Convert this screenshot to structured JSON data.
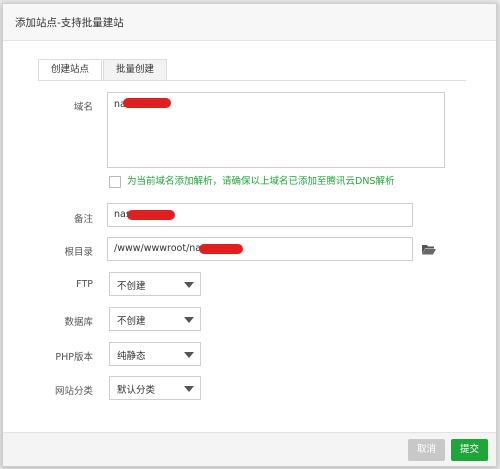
{
  "dialog": {
    "title": "添加站点-支持批量建站",
    "close_glyph": "✕"
  },
  "tabs": [
    {
      "label": "创建站点",
      "active": true
    },
    {
      "label": "批量创建",
      "active": false
    }
  ],
  "form": {
    "domain_label": "域名",
    "domain_value": "nas",
    "dns_checkbox_text": "为当前域名添加解析，请确保以上域名已添加至腾讯云DNS解析",
    "note_label": "备注",
    "note_value": "nas",
    "root_label": "根目录",
    "root_value": "/www/wwwroot/nas",
    "ftp_label": "FTP",
    "ftp_value": "不创建",
    "db_label": "数据库",
    "db_value": "不创建",
    "php_label": "PHP版本",
    "php_value": "纯静态",
    "category_label": "网站分类",
    "category_value": "默认分类"
  },
  "footer": {
    "cancel_label": "取消",
    "submit_label": "提交"
  },
  "colors": {
    "accent": "#20a53a",
    "redaction": "#e02020"
  },
  "icons": {
    "folder": "folder-open-icon",
    "dropdown": "caret-down-icon",
    "close": "close-icon"
  }
}
